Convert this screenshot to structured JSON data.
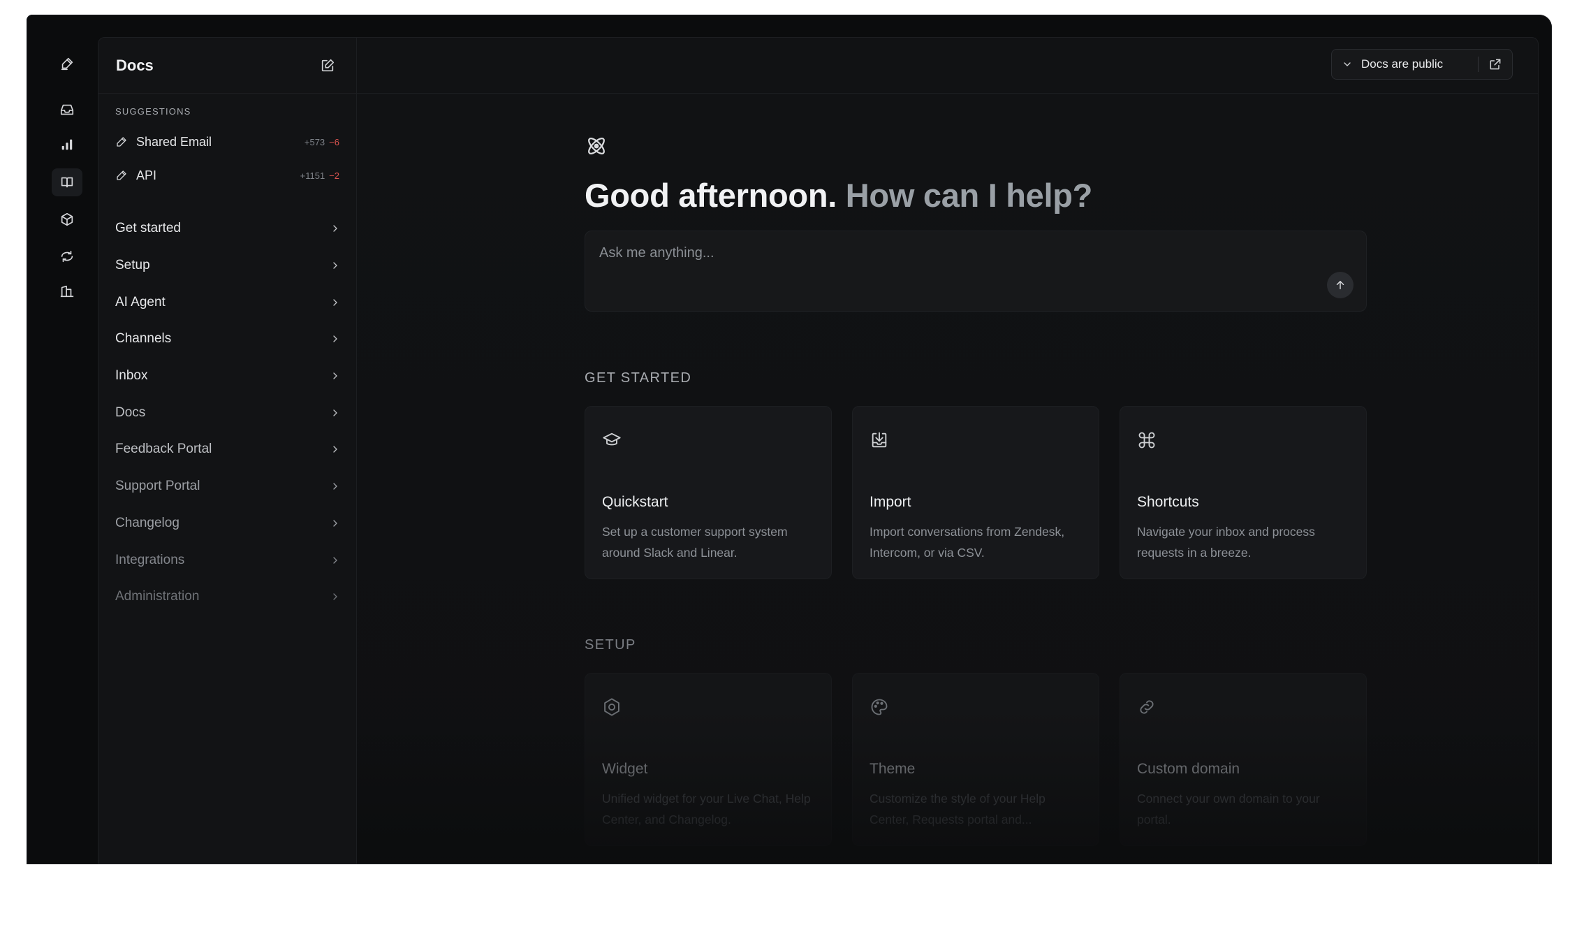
{
  "sidebar": {
    "title": "Docs",
    "suggestions_label": "SUGGESTIONS",
    "suggestions": [
      {
        "label": "Shared Email",
        "added": "+573",
        "removed": "−6"
      },
      {
        "label": "API",
        "added": "+1151",
        "removed": "−2"
      }
    ],
    "nav": [
      {
        "label": "Get started"
      },
      {
        "label": "Setup"
      },
      {
        "label": "AI Agent"
      },
      {
        "label": "Channels"
      },
      {
        "label": "Inbox"
      },
      {
        "label": "Docs"
      },
      {
        "label": "Feedback Portal"
      },
      {
        "label": "Support Portal"
      },
      {
        "label": "Changelog"
      },
      {
        "label": "Integrations"
      },
      {
        "label": "Administration"
      }
    ]
  },
  "header": {
    "visibility_label": "Docs are public"
  },
  "main": {
    "greeting_primary": "Good afternoon.",
    "greeting_secondary": "How can I help?",
    "ask_placeholder": "Ask me anything...",
    "get_started_label": "GET STARTED",
    "get_started_cards": [
      {
        "icon": "graduation-cap-icon",
        "title": "Quickstart",
        "desc": "Set up a customer support system around Slack and Linear."
      },
      {
        "icon": "import-icon",
        "title": "Import",
        "desc": "Import conversations from Zendesk, Intercom, or via CSV."
      },
      {
        "icon": "command-icon",
        "title": "Shortcuts",
        "desc": "Navigate your inbox and process requests in a breeze."
      }
    ],
    "setup_label": "SETUP",
    "setup_cards": [
      {
        "icon": "widget-icon",
        "title": "Widget",
        "desc": "Unified widget for your Live Chat, Help Center, and Changelog."
      },
      {
        "icon": "palette-icon",
        "title": "Theme",
        "desc": "Customize the style of your Help Center, Requests portal and..."
      },
      {
        "icon": "link-icon",
        "title": "Custom domain",
        "desc": "Connect your own domain to your portal."
      }
    ]
  }
}
